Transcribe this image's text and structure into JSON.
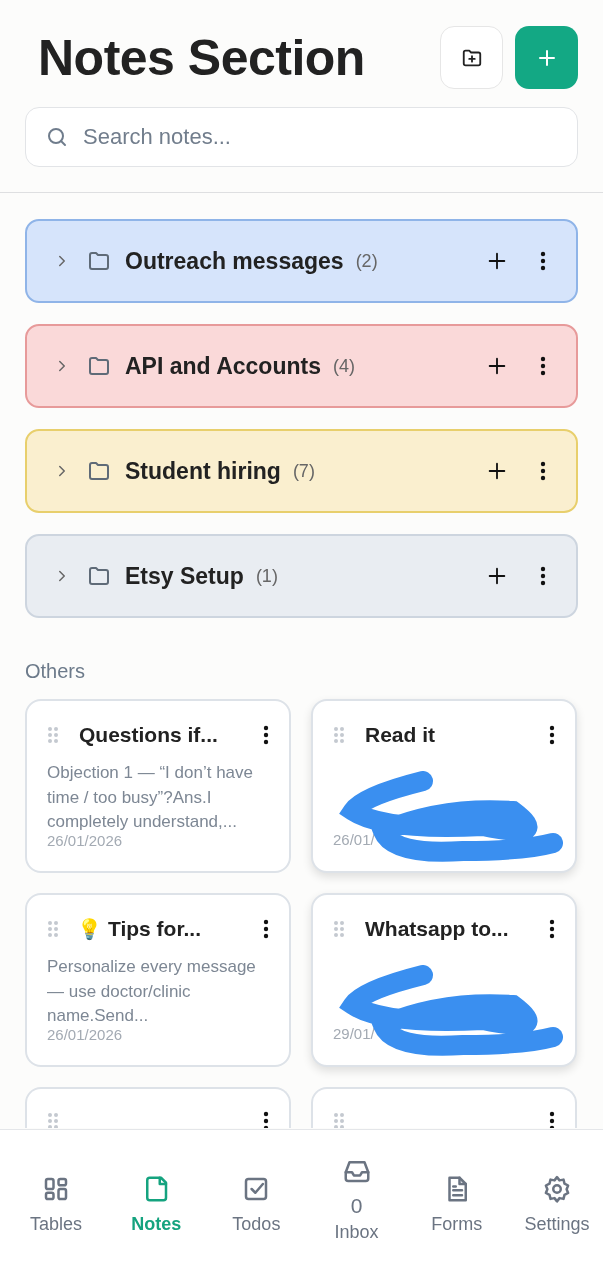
{
  "header": {
    "title": "Notes Section"
  },
  "search": {
    "placeholder": "Search notes..."
  },
  "folders": [
    {
      "name": "Outreach messages",
      "count": "(2)",
      "color": "#d6e4fb",
      "expanded": false
    },
    {
      "name": "API and Accounts",
      "count": "(4)",
      "color": "#fad9d9",
      "expanded": false
    },
    {
      "name": "Student hiring",
      "count": "(7)",
      "color": "#faefcf",
      "expanded": false
    },
    {
      "name": "Etsy Setup",
      "count": "(1)",
      "color": "#e9edf2",
      "expanded": false
    }
  ],
  "others": {
    "heading": "Others",
    "notes": [
      {
        "kind": "note",
        "title": "Questions if...",
        "preview": "Objection 1 — “I don’t have time / too busy”?Ans.I completely understand,...",
        "date": "26/01/2026"
      },
      {
        "kind": "redacted",
        "title": "Read it",
        "date": "26/01/"
      },
      {
        "kind": "note",
        "emoji": "💡",
        "title": "Tips for...",
        "preview": "Personalize every message — use doctor/clinic name.Send...",
        "date": "26/01/2026"
      },
      {
        "kind": "redacted",
        "title": "Whatsapp to...",
        "date": "29/01/"
      },
      {
        "kind": "hidden"
      },
      {
        "kind": "hidden"
      }
    ]
  },
  "nav": [
    {
      "label": "Tables",
      "selected": false
    },
    {
      "label": "Notes",
      "selected": true
    },
    {
      "label": "Todos",
      "selected": false
    },
    {
      "label": "Inbox",
      "count": "0",
      "selected": false
    },
    {
      "label": "Forms",
      "selected": false
    },
    {
      "label": "Settings",
      "selected": false
    }
  ]
}
